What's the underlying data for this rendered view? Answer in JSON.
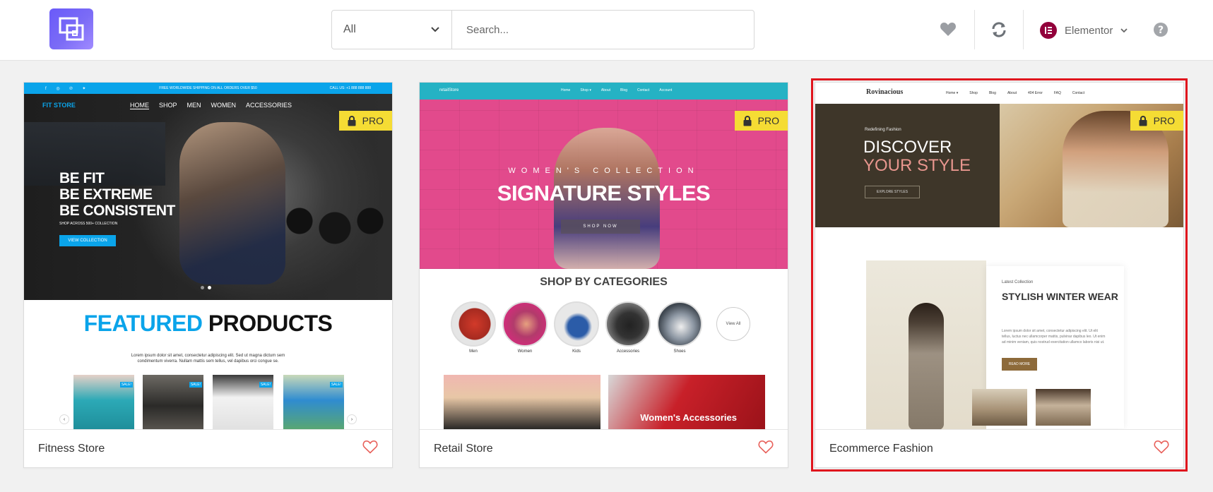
{
  "header": {
    "category_select": {
      "value": "All"
    },
    "search": {
      "placeholder": "Search..."
    },
    "favorites_icon": "heart-icon",
    "sync_icon": "sync-icon",
    "account": {
      "name": "Elementor",
      "badge_letter": "E"
    },
    "help_icon": "help-icon"
  },
  "colors": {
    "accent_logo": "#6a5af9",
    "pro_badge": "#f5dc34",
    "favorite_heart": "#e8605a",
    "selection_border": "#e0151d",
    "elementor_badge": "#92003b"
  },
  "templates": [
    {
      "title": "Fitness Store",
      "badge": "PRO",
      "selected": false,
      "preview": {
        "topbar_notice": "FREE WORLDWIDE SHIPPING ON ALL ORDERS OVER $50",
        "topbar_phone": "CALL US: +1 888 888 888",
        "brand": "FIT STORE",
        "menu": [
          "HOME",
          "SHOP",
          "MEN",
          "WOMEN",
          "ACCESSORIES"
        ],
        "headline": [
          "BE FIT",
          "BE EXTREME",
          "BE CONSISTENT"
        ],
        "subline": "SHOP ACROSS 500+ COLLECTION",
        "cta": "VIEW COLLECTION",
        "featured_blue": "FEATURED",
        "featured_black": "PRODUCTS",
        "featured_text": [
          "Lorem ipsum dolor sit amet, consectetur adipiscing elit. Sed ut magna dictum sem",
          "condimentum viverra. Nullam mattis sem tellus, vel dapibus orci congue se."
        ],
        "sale_label": "SALE!"
      }
    },
    {
      "title": "Retail Store",
      "badge": "PRO",
      "selected": false,
      "preview": {
        "brand": "retailStore",
        "menu": [
          "Home",
          "Shop ▾",
          "About",
          "Blog",
          "Contact",
          "Account"
        ],
        "kicker": "WOMEN'S COLLECTION",
        "headline": "SIGNATURE STYLES",
        "cta": "SHOP NOW",
        "section_title": "SHOP BY CATEGORIES",
        "categories": [
          "Men",
          "Women",
          "Kids",
          "Accessories",
          "Shoes"
        ],
        "view_all": "View All",
        "tile_label": "Women's Accessories"
      }
    },
    {
      "title": "Ecommerce Fashion",
      "badge": "PRO",
      "selected": true,
      "preview": {
        "brand": "Rovinacious",
        "menu": [
          "Home ▾",
          "Shop",
          "Blog",
          "About",
          "404 Error",
          "FAQ",
          "Contact"
        ],
        "kicker": "Redefining Fashion",
        "headline_line1": "DISCOVER",
        "headline_line2": "YOUR STYLE",
        "cta": "EXPLORE STYLES",
        "card_kicker": "Latest Collection",
        "card_title": "STYLISH WINTER WEAR",
        "card_text": "Lorem ipsum dolor sit amet, consectetur adipiscing elit. Ut elit tellus, luctus nec ullamcorper mattis, pulvinar dapibus leo. Ut enim ad minim veniam, quis nostrud exercitation ullamco laboris nisi ut.",
        "card_button": "READ MORE"
      }
    }
  ]
}
